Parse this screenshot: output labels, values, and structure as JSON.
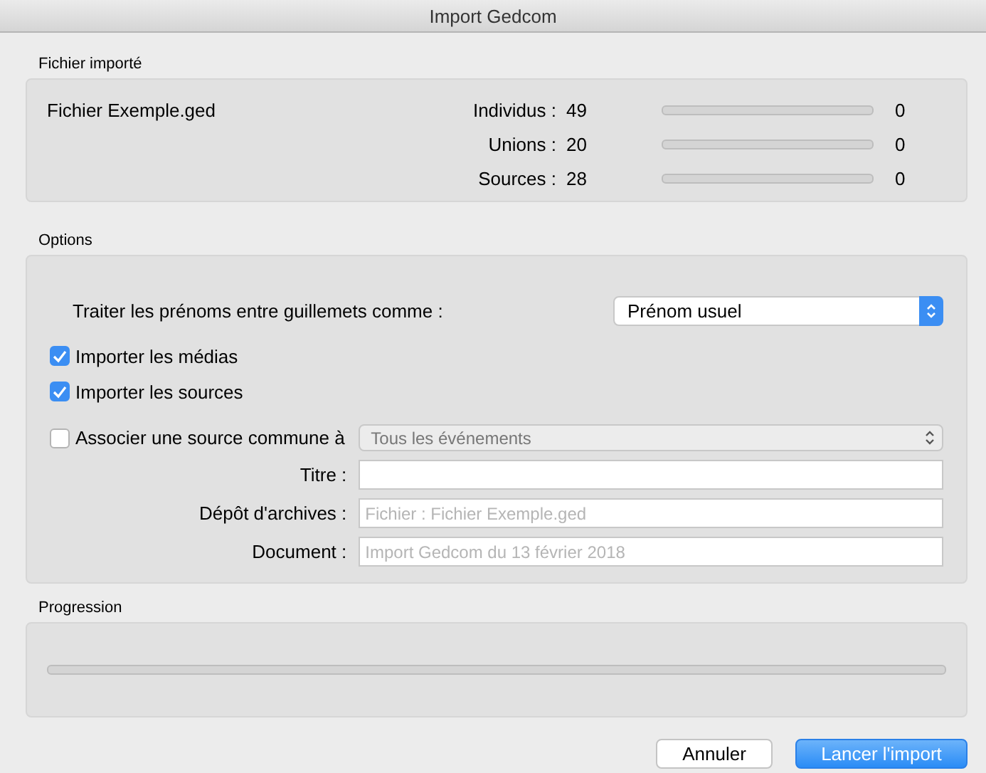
{
  "window": {
    "title": "Import Gedcom"
  },
  "imported_file": {
    "heading": "Fichier importé",
    "file_name": "Fichier Exemple.ged",
    "stats": [
      {
        "label": "Individus :",
        "total": "49",
        "level": 0,
        "count": "0"
      },
      {
        "label": "Unions :",
        "total": "20",
        "level": 0,
        "count": "0"
      },
      {
        "label": "Sources :",
        "total": "28",
        "level": 0,
        "count": "0"
      }
    ]
  },
  "options": {
    "heading": "Options",
    "quoted_names": {
      "label": "Traiter les prénoms entre guillemets comme :",
      "value": "Prénom usuel"
    },
    "checkboxes": [
      {
        "label": "Importer les médias",
        "checked": true
      },
      {
        "label": "Importer les sources",
        "checked": true
      }
    ],
    "common_source": {
      "label": "Associer une source commune à",
      "checked": false,
      "value": "Tous les événements",
      "disabled": true,
      "fields": [
        {
          "label": "Titre :"
        },
        {
          "label": "Dépôt d'archives :",
          "placeholder": "Fichier : Fichier Exemple.ged"
        },
        {
          "label": "Document :",
          "placeholder": "Import Gedcom du 13 février 2018"
        }
      ]
    }
  },
  "progress": {
    "heading": "Progression",
    "level": 0
  },
  "buttons": [
    {
      "label": "Annuler",
      "kind": "secondary"
    },
    {
      "label": "Lancer l'import",
      "kind": "primary"
    }
  ]
}
